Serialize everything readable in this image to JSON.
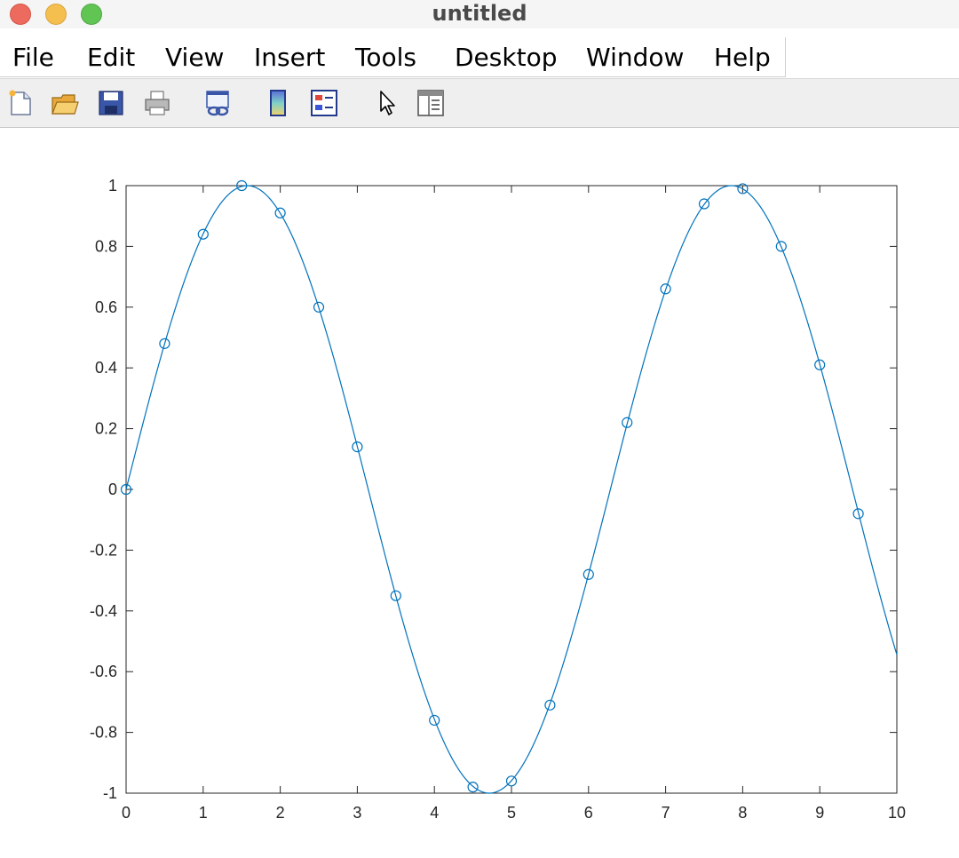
{
  "window": {
    "title": "untitled"
  },
  "menu": {
    "items": [
      {
        "id": "file",
        "label": "File"
      },
      {
        "id": "edit",
        "label": "Edit"
      },
      {
        "id": "view",
        "label": "View"
      },
      {
        "id": "insert",
        "label": "Insert"
      },
      {
        "id": "tools",
        "label": "Tools"
      },
      {
        "id": "desktop",
        "label": "Desktop"
      },
      {
        "id": "window",
        "label": "Window"
      },
      {
        "id": "help",
        "label": "Help"
      }
    ]
  },
  "toolbar": {
    "buttons": [
      {
        "id": "new-figure",
        "icon": "new-file-icon"
      },
      {
        "id": "open-file",
        "icon": "open-folder-icon"
      },
      {
        "id": "save-figure",
        "icon": "save-disk-icon"
      },
      {
        "id": "print-figure",
        "icon": "printer-icon"
      },
      {
        "id": "link-plot",
        "icon": "link-plot-icon"
      },
      {
        "id": "insert-colorbar",
        "icon": "colorbar-icon"
      },
      {
        "id": "insert-legend",
        "icon": "legend-icon"
      },
      {
        "id": "edit-plot",
        "icon": "arrow-pointer-icon"
      },
      {
        "id": "open-property-inspector",
        "icon": "property-inspector-icon"
      }
    ]
  },
  "chart_data": {
    "type": "line",
    "title": "",
    "xlabel": "",
    "ylabel": "",
    "xlim": [
      0,
      10
    ],
    "ylim": [
      -1,
      1
    ],
    "xticks": [
      0,
      1,
      2,
      3,
      4,
      5,
      6,
      7,
      8,
      9,
      10
    ],
    "yticks": [
      -1,
      -0.8,
      -0.6,
      -0.4,
      -0.2,
      0,
      0.2,
      0.4,
      0.6,
      0.8,
      1
    ],
    "xtick_labels": [
      "0",
      "1",
      "2",
      "3",
      "4",
      "5",
      "6",
      "7",
      "8",
      "9",
      "10"
    ],
    "ytick_labels": [
      "-1",
      "-0.8",
      "-0.6",
      "-0.4",
      "-0.2",
      "0",
      "0.2",
      "0.4",
      "0.6",
      "0.8",
      "1"
    ],
    "grid": false,
    "line_color": "#0072bd",
    "series": [
      {
        "style": "line",
        "function": "sin(x)",
        "x_range": [
          0,
          10
        ]
      },
      {
        "style": "marker-circle",
        "x": [
          0,
          0.5,
          1,
          1.5,
          2,
          2.5,
          3,
          3.5,
          4,
          4.5,
          5,
          5.5,
          6,
          6.5,
          7,
          7.5,
          8,
          8.5,
          9,
          9.5
        ],
        "y": [
          0,
          0.48,
          0.84,
          1.0,
          0.91,
          0.6,
          0.14,
          -0.35,
          -0.76,
          -0.98,
          -0.96,
          -0.71,
          -0.28,
          0.22,
          0.66,
          0.94,
          0.99,
          0.8,
          0.41,
          -0.08
        ]
      }
    ]
  }
}
